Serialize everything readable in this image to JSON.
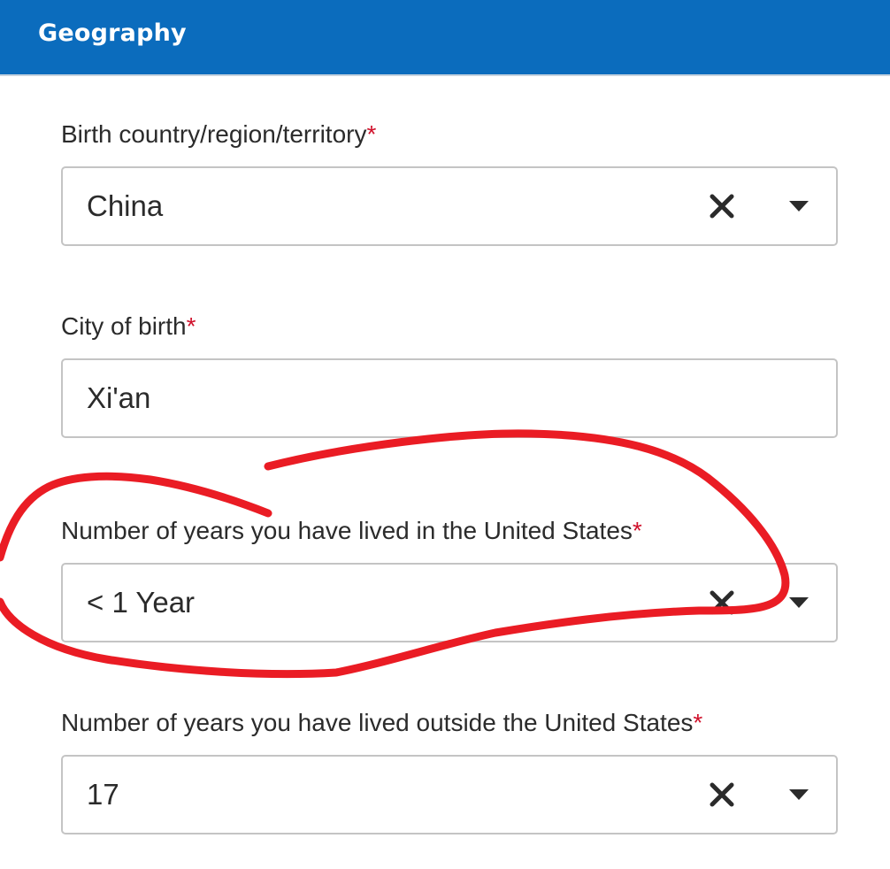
{
  "section": {
    "title": "Geography"
  },
  "required_mark": "*",
  "fields": [
    {
      "label": "Birth country/region/territory",
      "value": "China",
      "type": "select"
    },
    {
      "label": "City of birth",
      "value": "Xi'an",
      "type": "text"
    },
    {
      "label": "Number of years you have lived in the United States",
      "value": "< 1 Year",
      "type": "select"
    },
    {
      "label": "Number of years you have lived outside the United States",
      "value": "17",
      "type": "select"
    }
  ],
  "icons": {
    "clear": "close-icon",
    "dropdown": "caret-down-icon"
  },
  "colors": {
    "header_bg": "#0b6cbd",
    "required": "#d0112b",
    "annotation": "#ea1c24"
  }
}
